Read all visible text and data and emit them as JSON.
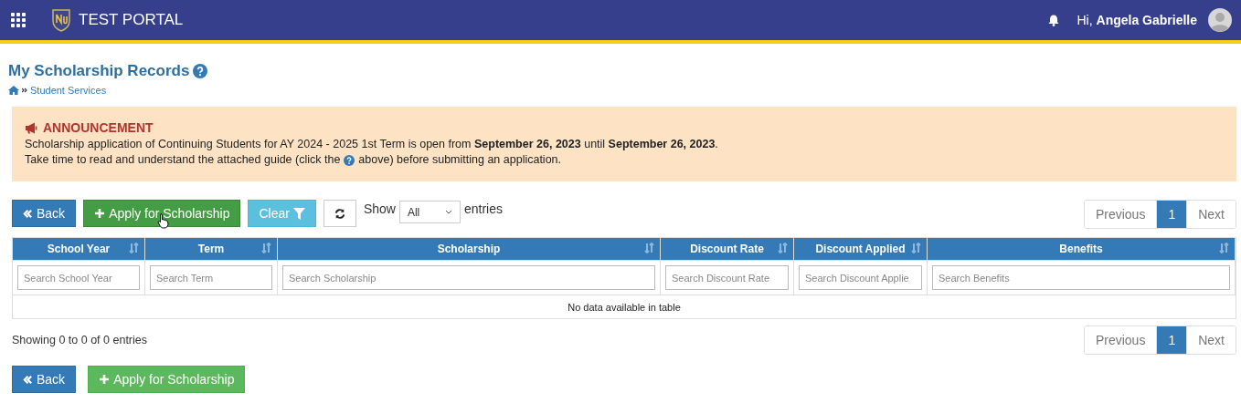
{
  "header": {
    "title": "TEST PORTAL",
    "greeting": "Hi,",
    "user_name": "Angela Gabrielle"
  },
  "page": {
    "title": "My Scholarship Records",
    "breadcrumb": "Student Services"
  },
  "announcement": {
    "heading": "ANNOUNCEMENT",
    "lines": [
      "Scholarship application of Continuing Students for AY 2024 - 2025 1st Term is open from **September 26, 2023** until **September 26, 2023**."
    ],
    "guide_before": "Take time to read and understand the attached guide (click the",
    "guide_after": "above) before submitting an application."
  },
  "toolbar": {
    "back": "Back",
    "apply": {
      "label": "Apply for Scholarship",
      "hovered": true
    },
    "clear": "Clear",
    "show_label": "Show",
    "page_length": "All",
    "entries_label": "entries"
  },
  "pagination_top": {
    "previous": "Previous",
    "pages": [
      {
        "label": "1",
        "selected": true
      }
    ],
    "next": "Next"
  },
  "table": {
    "columns": [
      {
        "label": "School Year",
        "placeholder": "Search School Year"
      },
      {
        "label": "Term",
        "placeholder": "Search Term"
      },
      {
        "label": "Scholarship",
        "placeholder": "Search Scholarship"
      },
      {
        "label": "Discount Rate",
        "placeholder": "Search Discount Rate"
      },
      {
        "label": "Discount Applied",
        "placeholder": "Search Discount Applie"
      },
      {
        "label": "Benefits",
        "placeholder": "Search Benefits"
      }
    ],
    "empty_message": "No data available in table"
  },
  "info": "Showing 0 to 0 of 0 entries",
  "pagination_bottom": {
    "previous": "Previous",
    "pages": [
      {
        "label": "1",
        "selected": true
      }
    ],
    "next": "Next"
  },
  "footer_buttons": {
    "back": "Back",
    "apply": {
      "label": "Apply for Scholarship",
      "hovered": false
    }
  }
}
